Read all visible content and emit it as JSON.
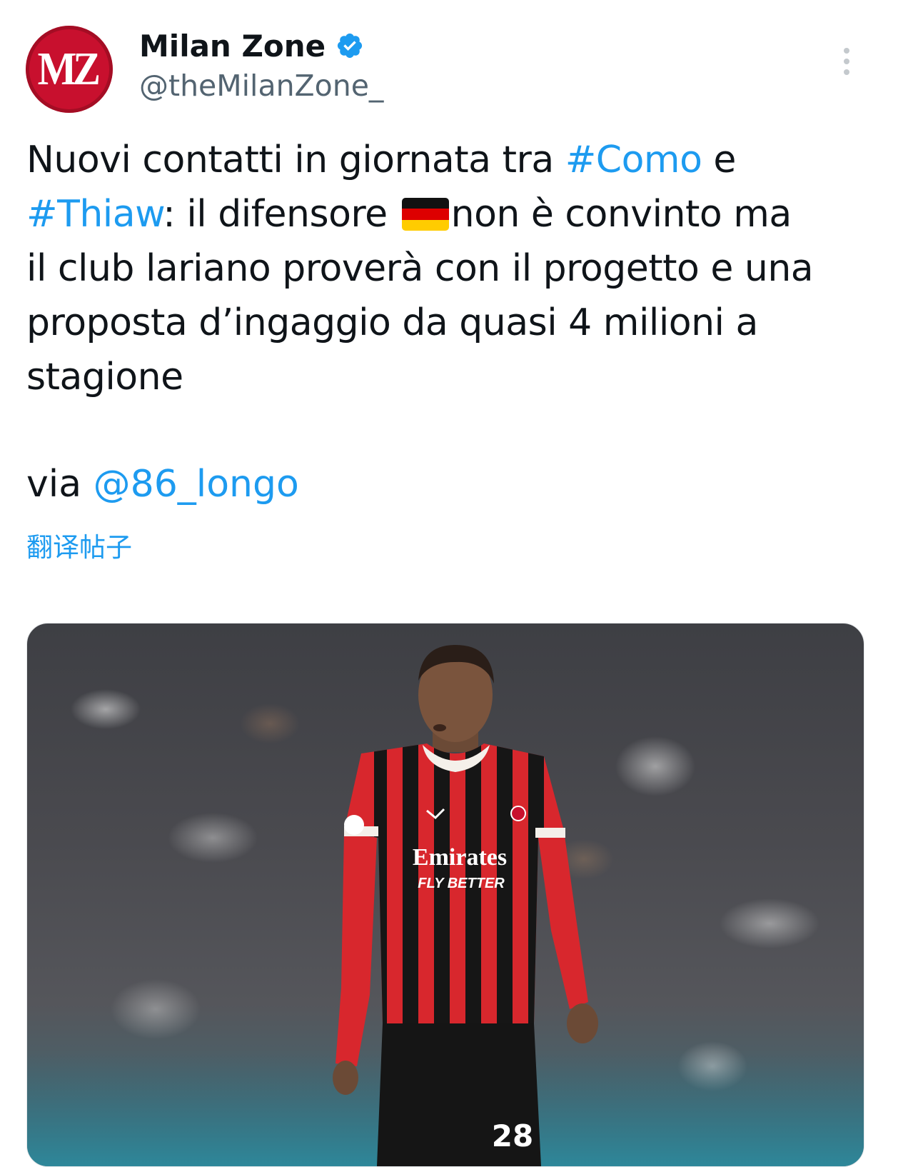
{
  "author": {
    "display_name": "Milan Zone",
    "handle": "@theMilanZone_",
    "avatar_text": "MZ",
    "verified": true
  },
  "tweet": {
    "line1_pre": "Nuovi contatti in giornata tra ",
    "line1_hashtag": "#Como",
    "line1_post": " e",
    "line2_hashtag": "#Thiaw",
    "line2_mid": ": il difensore ",
    "line2_flag": "germany-flag",
    "line2_post": "non è convinto ma",
    "line3": "il club lariano proverà con il progetto e una",
    "line4": "proposta d’ingaggio da quasi 4 milioni a",
    "line5": "stagione",
    "via_prefix": "via ",
    "via_mention": "@86_longo"
  },
  "translate_label": "翻译帖子",
  "media": {
    "shirt_sponsor": "Emirates",
    "shirt_slogan": "FLY BETTER",
    "shirt_number": "28"
  },
  "colors": {
    "link": "#1d9bf0",
    "secondary_text": "#536471",
    "avatar_bg": "#c8102e",
    "kit_red": "#d8272d",
    "kit_black": "#161616"
  }
}
